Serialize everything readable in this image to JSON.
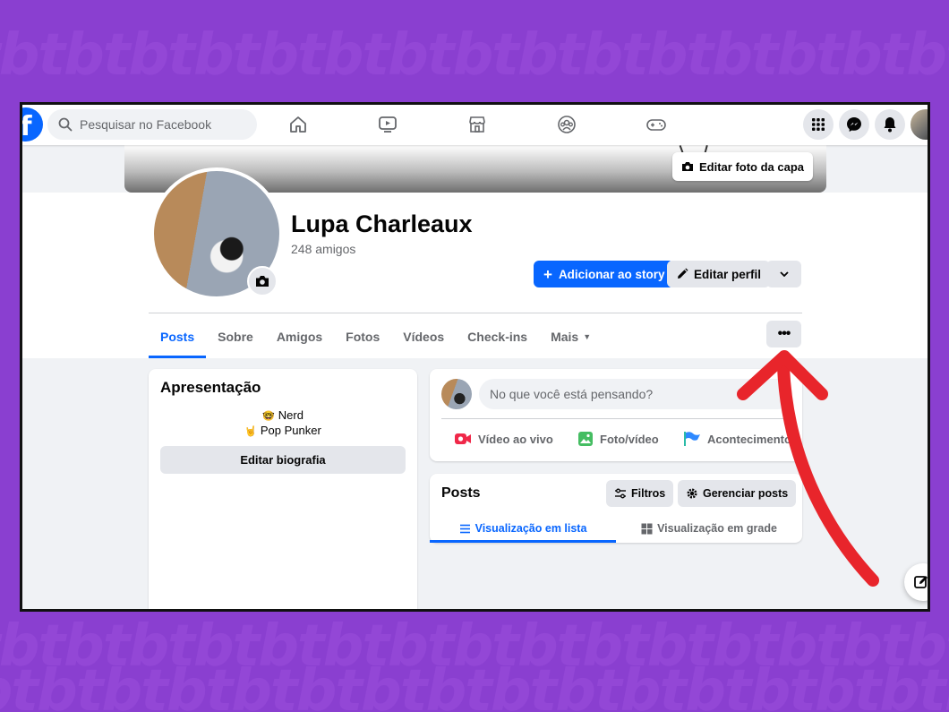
{
  "nav": {
    "search_placeholder": "Pesquisar no Facebook",
    "logo": "facebook-logo",
    "icons": [
      "home-icon",
      "watch-icon",
      "marketplace-icon",
      "groups-icon",
      "gaming-icon"
    ],
    "right_icons": [
      "menu-grid-icon",
      "messenger-icon",
      "notifications-icon"
    ]
  },
  "cover": {
    "edit_label": "Editar foto da capa"
  },
  "profile": {
    "name": "Lupa Charleaux",
    "friends": "248 amigos",
    "add_story": "Adicionar ao story",
    "edit_profile": "Editar perfil"
  },
  "tabs": [
    "Posts",
    "Sobre",
    "Amigos",
    "Fotos",
    "Vídeos",
    "Check-ins",
    "Mais"
  ],
  "intro": {
    "title": "Apresentação",
    "line1": "Nerd",
    "line2": "Pop Punker",
    "line1_emoji": "🤓",
    "line2_emoji": "🤘",
    "edit_bio": "Editar biografia"
  },
  "composer": {
    "placeholder": "No que você está pensando?",
    "live": "Vídeo ao vivo",
    "photo": "Foto/vídeo",
    "event": "Acontecimento"
  },
  "posts": {
    "title": "Posts",
    "filters": "Filtros",
    "manage": "Gerenciar posts",
    "list_view": "Visualização em lista",
    "grid_view": "Visualização em grade"
  },
  "colors": {
    "accent": "#0866ff",
    "background": "#8a3fd0",
    "annotation_arrow": "#e8252b"
  }
}
